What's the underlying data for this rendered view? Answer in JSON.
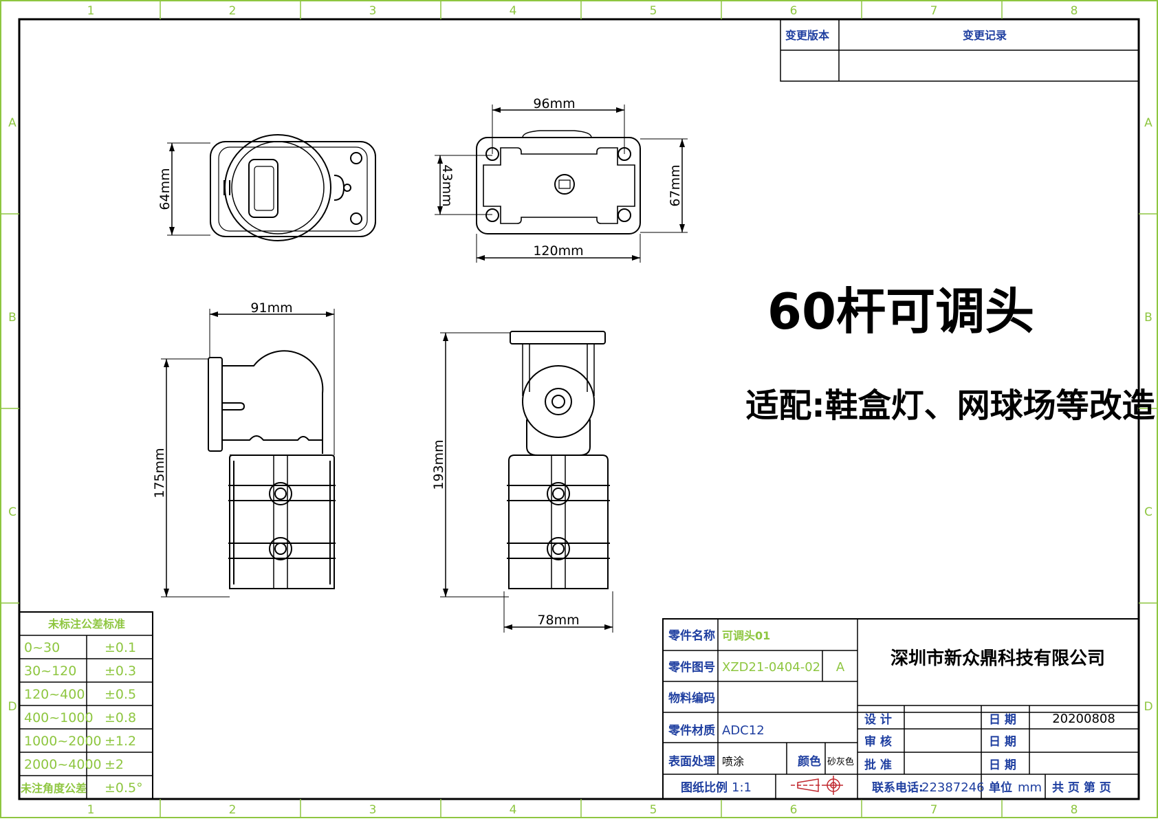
{
  "frame": {
    "col_labels": [
      "1",
      "2",
      "3",
      "4",
      "5",
      "6",
      "7",
      "8"
    ],
    "row_labels": [
      "A",
      "B",
      "C",
      "D"
    ]
  },
  "revision_table": {
    "version_header": "变更版本",
    "record_header": "变更记录"
  },
  "title": {
    "main": "60杆可调头",
    "subtitle": "适配:鞋盒灯、网球场等改造"
  },
  "dimensions": {
    "top_left_height": "64mm",
    "top_right_width": "96mm",
    "top_right_inner": "43mm",
    "top_right_height": "67mm",
    "top_right_bottom": "120mm",
    "side_width": "91mm",
    "side_height": "175mm",
    "front_height": "193mm",
    "front_width": "78mm"
  },
  "tolerance_table": {
    "header": "未标注公差标准",
    "rows": [
      {
        "range": "0~30",
        "tol": "±0.1"
      },
      {
        "range": "30~120",
        "tol": "±0.3"
      },
      {
        "range": "120~400",
        "tol": "±0.5"
      },
      {
        "range": "400~1000",
        "tol": "±0.8"
      },
      {
        "range": "1000~2000",
        "tol": "±1.2"
      },
      {
        "range": "2000~4000",
        "tol": "±2"
      },
      {
        "range": "未注角度公差",
        "tol": "±0.5°"
      }
    ]
  },
  "title_block": {
    "part_name_label": "零件名称",
    "part_name": "可调头01",
    "drawing_no_label": "零件图号",
    "drawing_no": "XZD21-0404-02",
    "revision": "A",
    "material_code_label": "物料编码",
    "material_label": "零件材质",
    "material": "ADC12",
    "surface_label": "表面处理",
    "surface": "喷涂",
    "color_label": "颜色",
    "color": "砂灰色",
    "scale_label": "图纸比例",
    "scale": "1:1",
    "company": "深圳市新众鼎科技有限公司",
    "design_label": "设 计",
    "review_label": "审 核",
    "approve_label": "批 准",
    "date_label": "日 期",
    "design_date": "20200808",
    "phone_label": "联系电话:",
    "phone": "22387246",
    "unit_label": "单位",
    "unit": "mm",
    "pages": "共  页 第  页"
  }
}
